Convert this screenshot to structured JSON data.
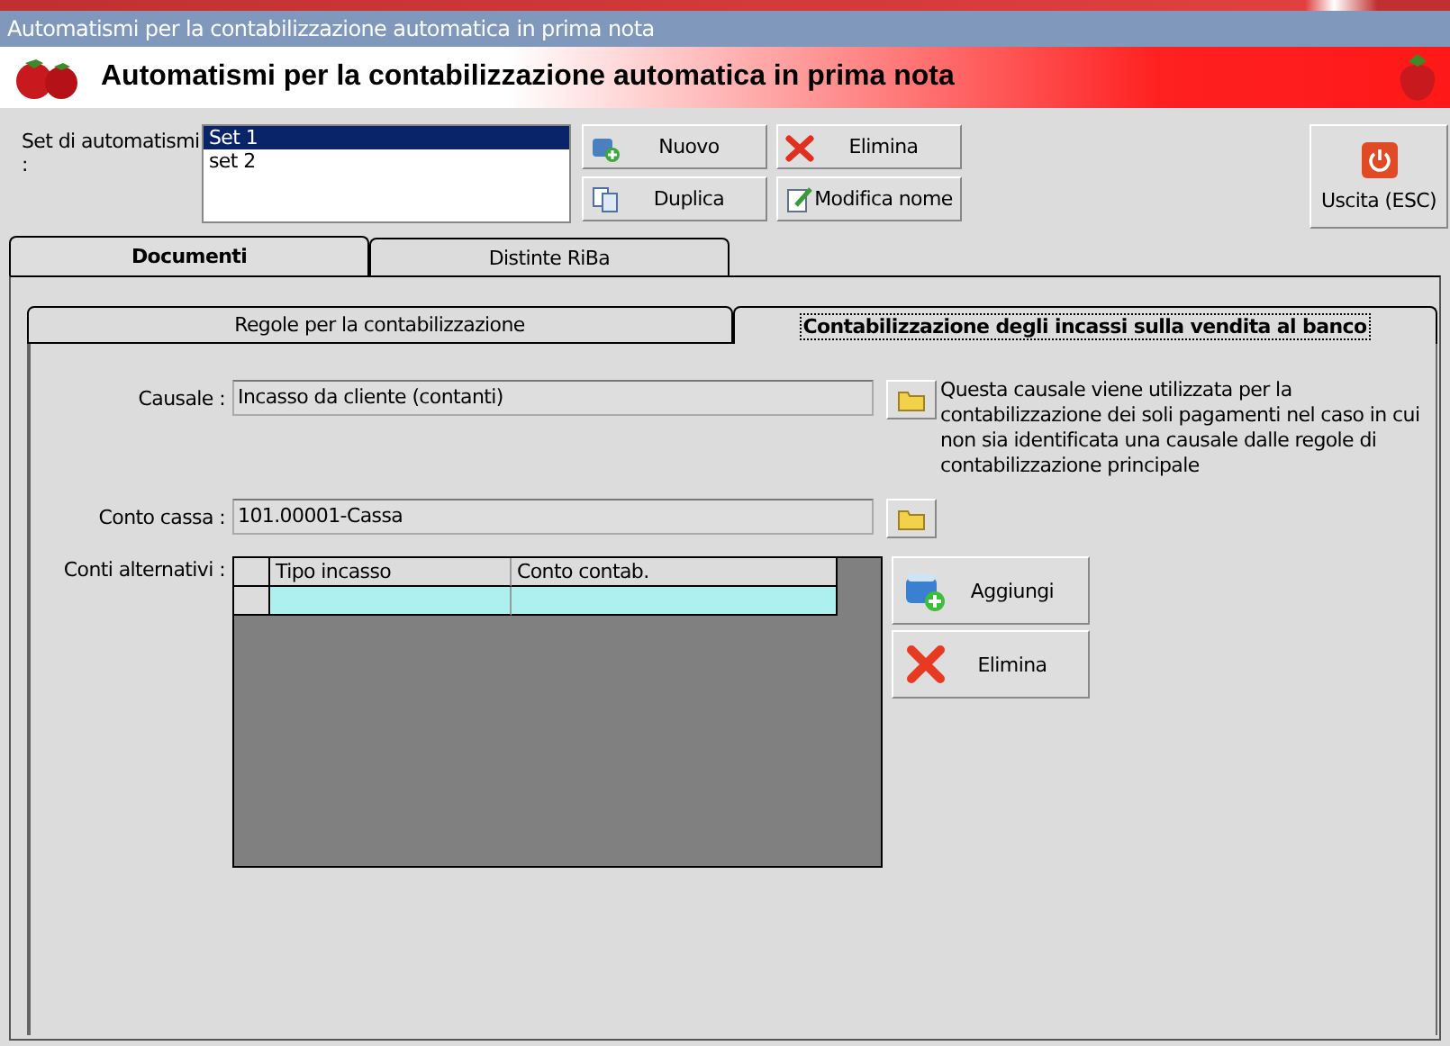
{
  "window": {
    "title": "Automatismi per la contabilizzazione automatica in prima nota"
  },
  "header": {
    "title": "Automatismi per la contabilizzazione automatica in prima nota"
  },
  "set_list": {
    "label": "Set di automatismi :",
    "items": [
      {
        "label": "Set 1",
        "selected": true
      },
      {
        "label": "set 2",
        "selected": false
      }
    ]
  },
  "buttons": [
    {
      "label": "Nuovo",
      "kind": "new"
    },
    {
      "label": "Elimina",
      "kind": "delete"
    },
    {
      "label": "Duplica",
      "kind": "copy"
    },
    {
      "label": "Modifica nome",
      "kind": "rename"
    }
  ],
  "exit_button": {
    "label": "Uscita (ESC)"
  },
  "tabs": [
    {
      "label": "Documenti",
      "selected": true
    },
    {
      "label": "Distinte RiBa",
      "selected": false
    }
  ],
  "subtabs": [
    {
      "label": "Regole per la contabilizzazione",
      "selected": false
    },
    {
      "label": "Contabilizzazione degli incassi sulla vendita al banco",
      "selected": true
    }
  ],
  "causale": {
    "label": "Causale :",
    "value": "Incasso da cliente (contanti)",
    "note": "Questa causale viene utilizzata per la contabilizzazione dei soli pagamenti nel caso in cui non sia identificata una causale dalle regole di contabilizzazione principale"
  },
  "conto_cassa": {
    "label": "Conto cassa :",
    "value": "101.00001-Cassa"
  },
  "conti_alternativi": {
    "label": "Conti alternativi :",
    "columns": [
      "Tipo incasso",
      "Conto contab."
    ],
    "rows": [
      {
        "selected": true
      }
    ]
  },
  "grid_buttons": [
    {
      "label": "Aggiungi",
      "kind": "add"
    },
    {
      "label": "Elimina",
      "kind": "delete"
    }
  ]
}
